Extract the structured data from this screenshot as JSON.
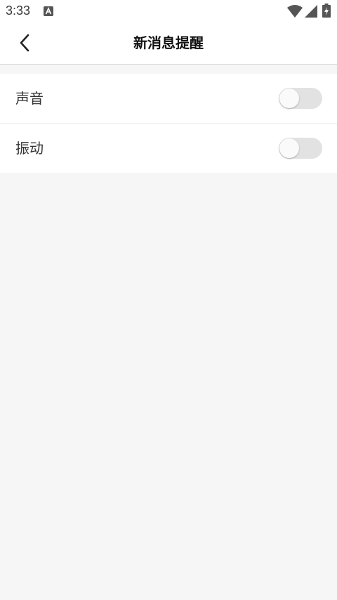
{
  "status_bar": {
    "time": "3:33",
    "notification_icon": "font-a-icon",
    "wifi_icon": "wifi-icon",
    "signal_icon": "cell-signal-icon",
    "battery_icon": "battery-charging-icon"
  },
  "header": {
    "back_icon": "chevron-left-icon",
    "title": "新消息提醒"
  },
  "settings": [
    {
      "label": "声音",
      "enabled": false
    },
    {
      "label": "振动",
      "enabled": false
    }
  ],
  "colors": {
    "toggle_off_track": "#e2e2e2",
    "background": "#f6f6f6"
  }
}
